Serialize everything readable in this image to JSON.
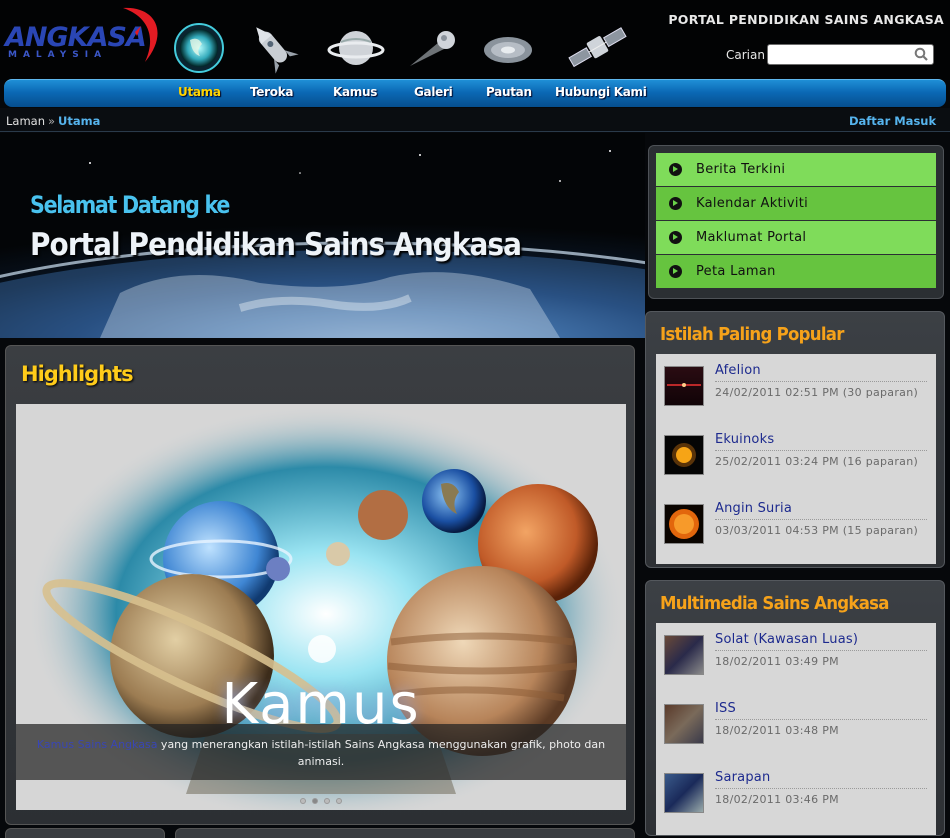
{
  "header": {
    "logo_text": "ANGKASA",
    "logo_sub": "MALAYSIA",
    "portal_title": "PORTAL PENDIDIKAN SAINS ANGKASA",
    "search": {
      "label": "Carian",
      "value": "",
      "placeholder": ""
    }
  },
  "nav": {
    "items": [
      {
        "label": "Utama",
        "active": true
      },
      {
        "label": "Teroka"
      },
      {
        "label": "Kamus"
      },
      {
        "label": "Galeri"
      },
      {
        "label": "Pautan"
      },
      {
        "label": "Hubungi Kami"
      }
    ]
  },
  "breadcrumb": {
    "home": "Laman",
    "sep": "»",
    "current": "Utama",
    "login": "Daftar Masuk"
  },
  "hero": {
    "line1": "Selamat Datang ke",
    "line2": "Portal Pendidikan Sains Angkasa"
  },
  "highlights": {
    "title": "Highlights",
    "slide_title": "Kamus",
    "caption_link": "Kamus Sains Angkasa",
    "caption_text": " yang menerangkan istilah-istilah Sains Angkasa menggunakan grafik, photo dan animasi.",
    "slide_count": 4,
    "active_slide": 2
  },
  "side_menu": {
    "items": [
      "Berita Terkini",
      "Kalendar Aktiviti",
      "Maklumat Portal",
      "Peta Laman"
    ]
  },
  "popular": {
    "title": "Istilah Paling Popular",
    "items": [
      {
        "name": "Afelion",
        "meta": "24/02/2011 02:51 PM (30 paparan)"
      },
      {
        "name": "Ekuinoks",
        "meta": "25/02/2011 03:24 PM (16 paparan)"
      },
      {
        "name": "Angin Suria",
        "meta": "03/03/2011 04:53 PM (15 paparan)"
      }
    ]
  },
  "multimedia": {
    "title": "Multimedia Sains Angkasa",
    "items": [
      {
        "name": "Solat (Kawasan Luas)",
        "meta": "18/02/2011 03:49 PM"
      },
      {
        "name": "ISS",
        "meta": "18/02/2011 03:48 PM"
      },
      {
        "name": "Sarapan",
        "meta": "18/02/2011 03:46 PM"
      }
    ]
  },
  "colors": {
    "nav_active": "#ffd400",
    "panel_title": "#f6a21a",
    "highlight_title": "#ffcc1a",
    "menu_green": "#6ad24a",
    "link": "#1d2a8e"
  }
}
